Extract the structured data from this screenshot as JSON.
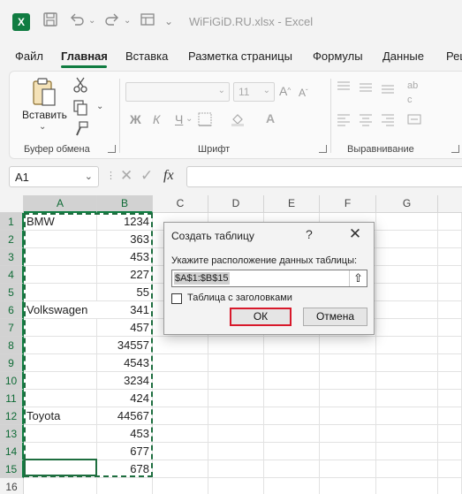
{
  "app": {
    "logo": "X",
    "filename": "WiFiGiD.RU.xlsx  -  Excel"
  },
  "tabs": [
    "Файл",
    "Главная",
    "Вставка",
    "Разметка страницы",
    "Формулы",
    "Данные",
    "Рец"
  ],
  "ribbon": {
    "clipboard": {
      "paste_label": "Вставить",
      "group_label": "Буфер обмена"
    },
    "font": {
      "size": "11",
      "bold": "Ж",
      "italic": "К",
      "underline": "Ч",
      "group_label": "Шрифт"
    },
    "alignment": {
      "group_label": "Выравнивание"
    }
  },
  "formula_bar": {
    "name_box": "A1",
    "fx": "fx",
    "formula": ""
  },
  "sheet": {
    "columns": [
      "A",
      "B",
      "C",
      "D",
      "E",
      "F",
      "G"
    ],
    "rows": [
      {
        "num": "1",
        "a": "BMW",
        "b": "1234"
      },
      {
        "num": "2",
        "a": "",
        "b": "363"
      },
      {
        "num": "3",
        "a": "",
        "b": "453"
      },
      {
        "num": "4",
        "a": "",
        "b": "227"
      },
      {
        "num": "5",
        "a": "",
        "b": "55"
      },
      {
        "num": "6",
        "a": "Volkswagen",
        "b": "341"
      },
      {
        "num": "7",
        "a": "",
        "b": "457"
      },
      {
        "num": "8",
        "a": "",
        "b": "34557"
      },
      {
        "num": "9",
        "a": "",
        "b": "4543"
      },
      {
        "num": "10",
        "a": "",
        "b": "3234"
      },
      {
        "num": "11",
        "a": "",
        "b": "424"
      },
      {
        "num": "12",
        "a": "Toyota",
        "b": "44567"
      },
      {
        "num": "13",
        "a": "",
        "b": "453"
      },
      {
        "num": "14",
        "a": "",
        "b": "677"
      },
      {
        "num": "15",
        "a": "",
        "b": "678"
      },
      {
        "num": "16",
        "a": "",
        "b": ""
      }
    ]
  },
  "dialog": {
    "title": "Создать таблицу",
    "help": "?",
    "close": "✕",
    "prompt": "Укажите расположение данных таблицы:",
    "range": "$A$1:$B$15",
    "collapse": "⇧",
    "checkbox_label": "Таблица с заголовками",
    "checkbox_checked": false,
    "ok": "ОК",
    "cancel": "Отмена"
  },
  "colors": {
    "accent": "#107c41",
    "highlight": "#d8192b"
  }
}
